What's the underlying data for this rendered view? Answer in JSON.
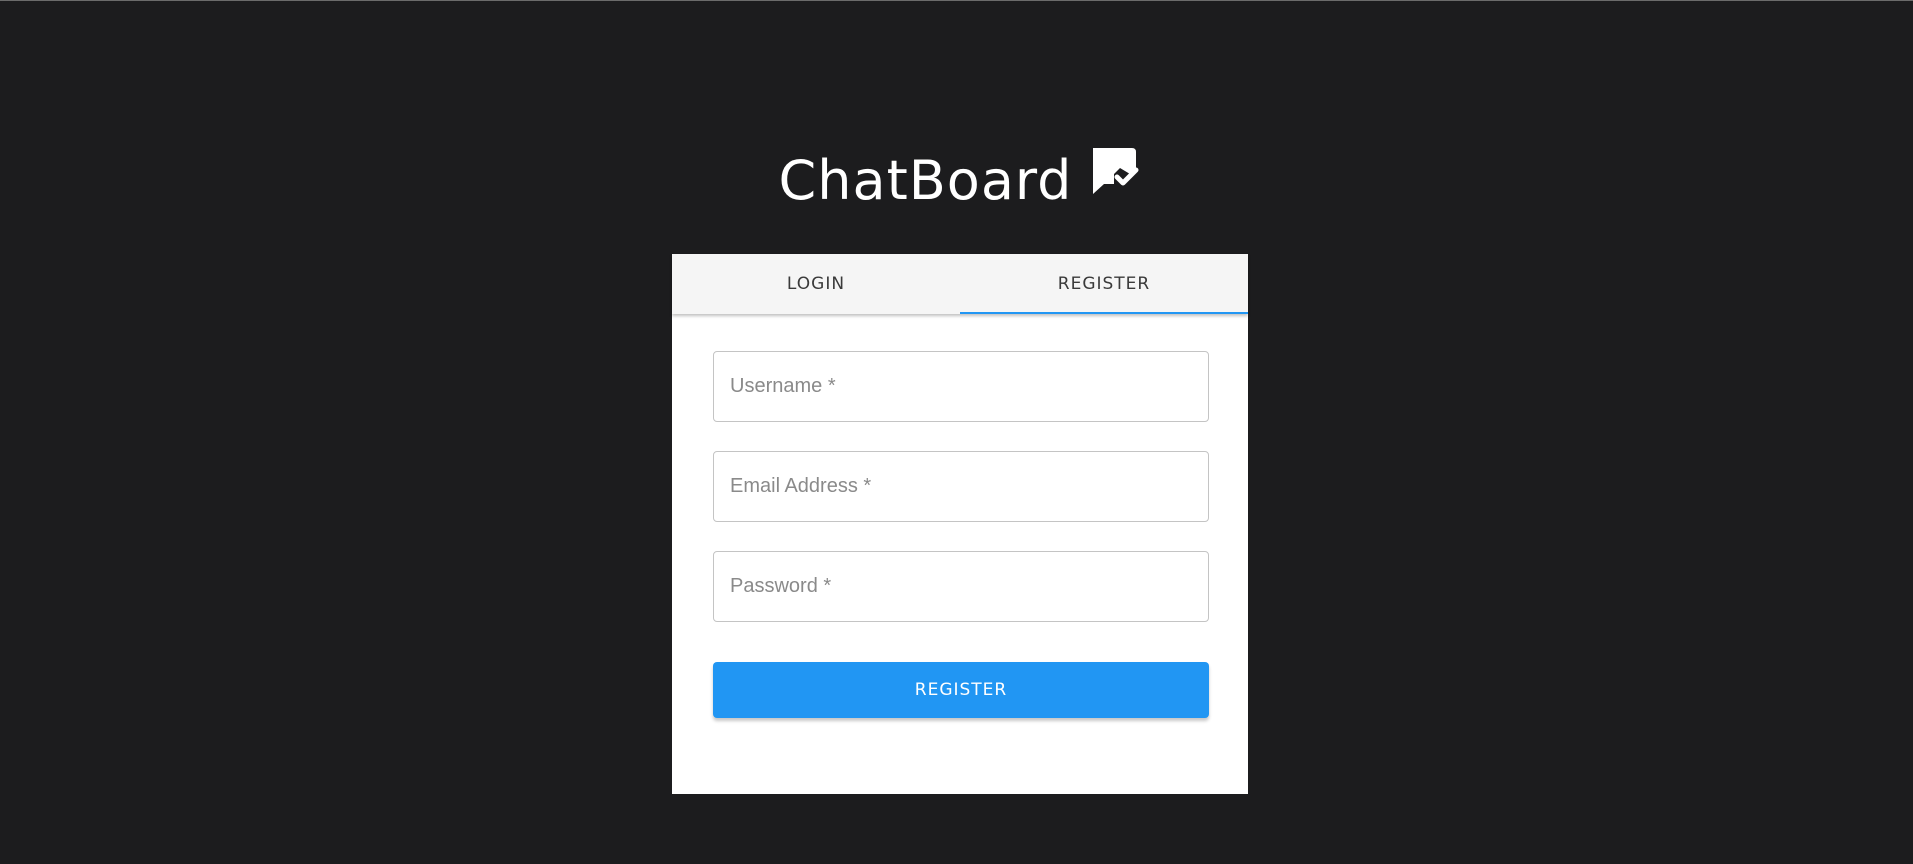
{
  "brand": {
    "title": "ChatBoard",
    "icon": "chat-check-icon"
  },
  "tabs": [
    {
      "label": "LOGIN",
      "active": false
    },
    {
      "label": "REGISTER",
      "active": true
    }
  ],
  "form": {
    "username": {
      "placeholder": "Username *",
      "value": ""
    },
    "email": {
      "placeholder": "Email Address *",
      "value": ""
    },
    "password": {
      "placeholder": "Password *",
      "value": ""
    },
    "submit_label": "REGISTER"
  },
  "colors": {
    "background": "#1c1c1e",
    "accent": "#2196f3",
    "tab_bar": "#f5f5f5"
  }
}
